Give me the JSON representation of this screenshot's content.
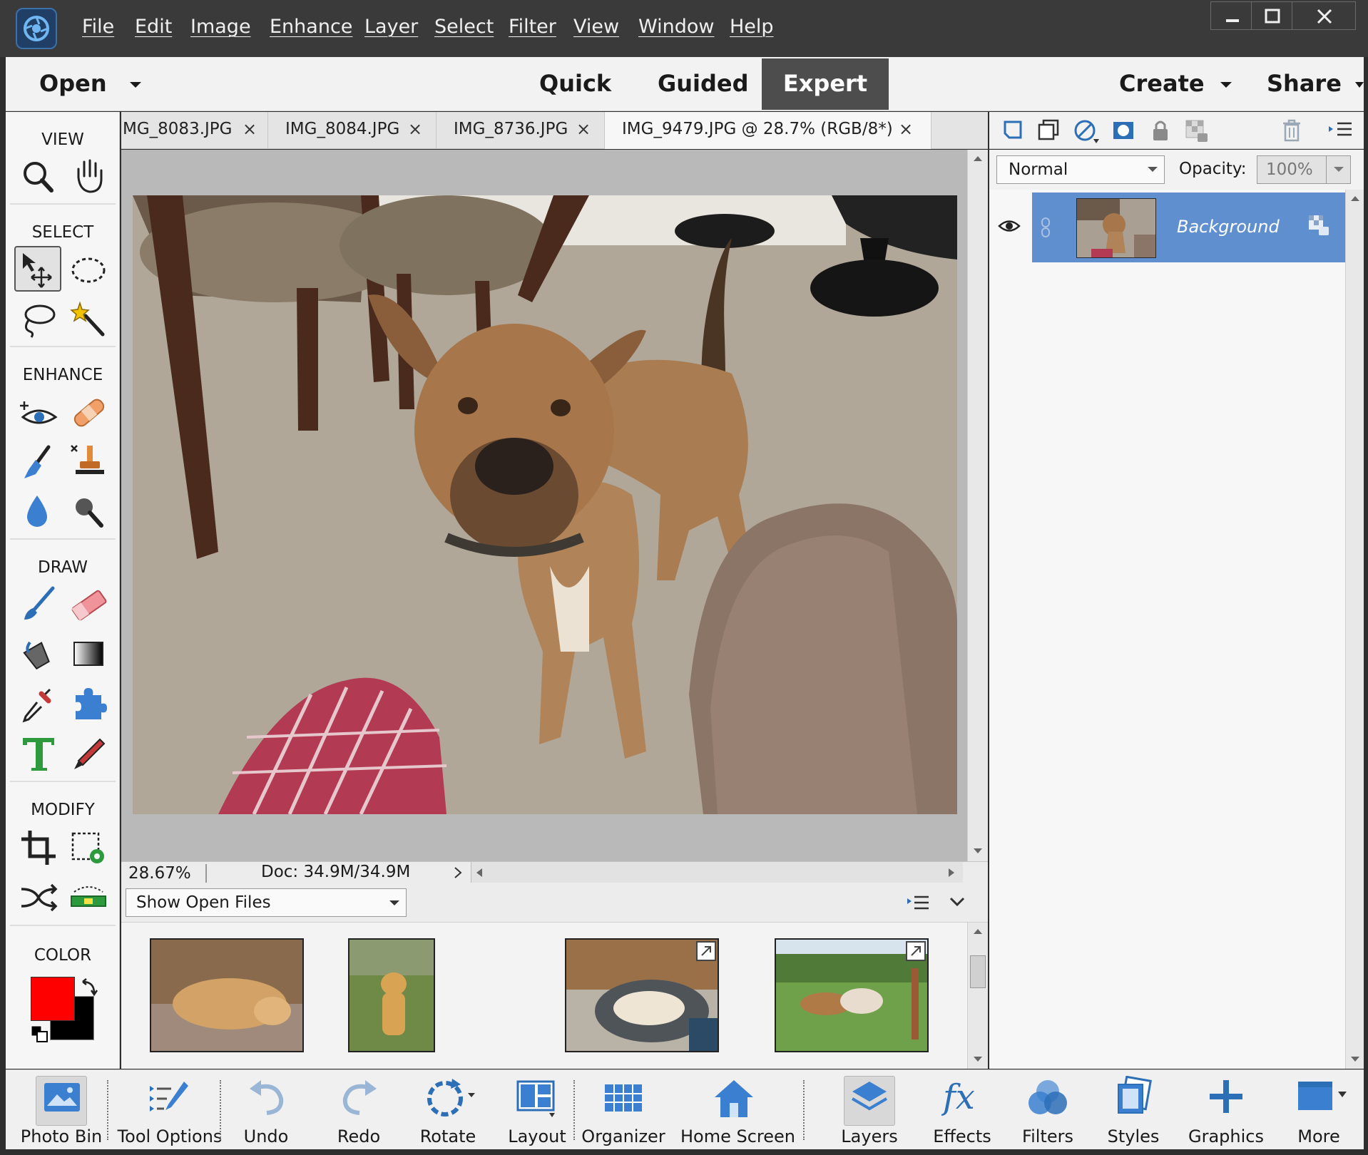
{
  "menu": [
    "File",
    "Edit",
    "Image",
    "Enhance",
    "Layer",
    "Select",
    "Filter",
    "View",
    "Window",
    "Help"
  ],
  "modes": {
    "open": "Open",
    "quick": "Quick",
    "guided": "Guided",
    "expert": "Expert",
    "create": "Create",
    "share": "Share"
  },
  "toolbox": {
    "view": "VIEW",
    "select": "SELECT",
    "enhance": "ENHANCE",
    "draw": "DRAW",
    "modify": "MODIFY",
    "color": "COLOR",
    "foreground_color": "#ff0000",
    "background_color": "#000000"
  },
  "doc_tabs": [
    {
      "label": "MG_8083.JPG"
    },
    {
      "label": "IMG_8084.JPG"
    },
    {
      "label": "IMG_8736.JPG"
    },
    {
      "label": "IMG_9479.JPG @ 28.7% (RGB/8*)"
    }
  ],
  "tab_close_glyph": "×",
  "tabs_more_glyph": "››",
  "status": {
    "zoom": "28.67%",
    "doc": "Doc: 34.9M/34.9M"
  },
  "photo_bin": {
    "dropdown": "Show Open Files"
  },
  "layers": {
    "blend_mode": "Normal",
    "opacity_label": "Opacity:",
    "opacity_value": "100%",
    "layer_name": "Background"
  },
  "taskbar": [
    {
      "label": "Photo Bin"
    },
    {
      "label": "Tool Options"
    },
    {
      "label": "Undo"
    },
    {
      "label": "Redo"
    },
    {
      "label": "Rotate"
    },
    {
      "label": "Layout"
    },
    {
      "label": "Organizer"
    },
    {
      "label": "Home Screen"
    },
    {
      "label": "Layers"
    },
    {
      "label": "Effects"
    },
    {
      "label": "Filters"
    },
    {
      "label": "Styles"
    },
    {
      "label": "Graphics"
    },
    {
      "label": "More"
    }
  ],
  "colors": {
    "accent_blue": "#5f8fcf",
    "menubar": "#3a3a3a",
    "expert_tab": "#4d4d4d"
  }
}
